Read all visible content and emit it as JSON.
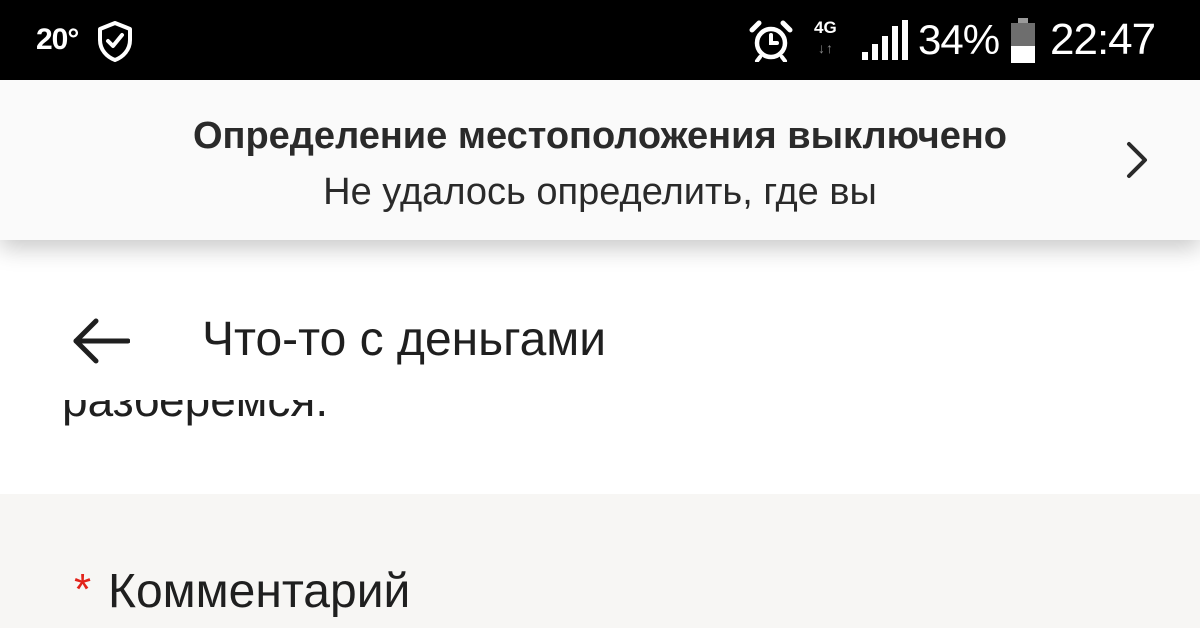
{
  "status_bar": {
    "temperature": "20°",
    "network_type": "4G",
    "battery_percent": "34%",
    "time": "22:47",
    "icons": [
      "shield-check-icon",
      "alarm-clock-icon",
      "signal-strength-icon",
      "battery-icon"
    ]
  },
  "location_banner": {
    "title": "Определение местоположения выключено",
    "subtitle": "Не удалось определить, где вы",
    "icon": "chevron-right-icon"
  },
  "header": {
    "title": "Что-то с деньгами",
    "back_icon": "back-arrow-icon"
  },
  "content": {
    "partial_text": "разберемся.",
    "comment_field": {
      "required_mark": "*",
      "label": "Комментарий"
    }
  },
  "colors": {
    "status_bar_bg": "#000000",
    "banner_bg": "#fafafa",
    "section_bg": "#f7f6f4",
    "required_red": "#e2231a"
  }
}
